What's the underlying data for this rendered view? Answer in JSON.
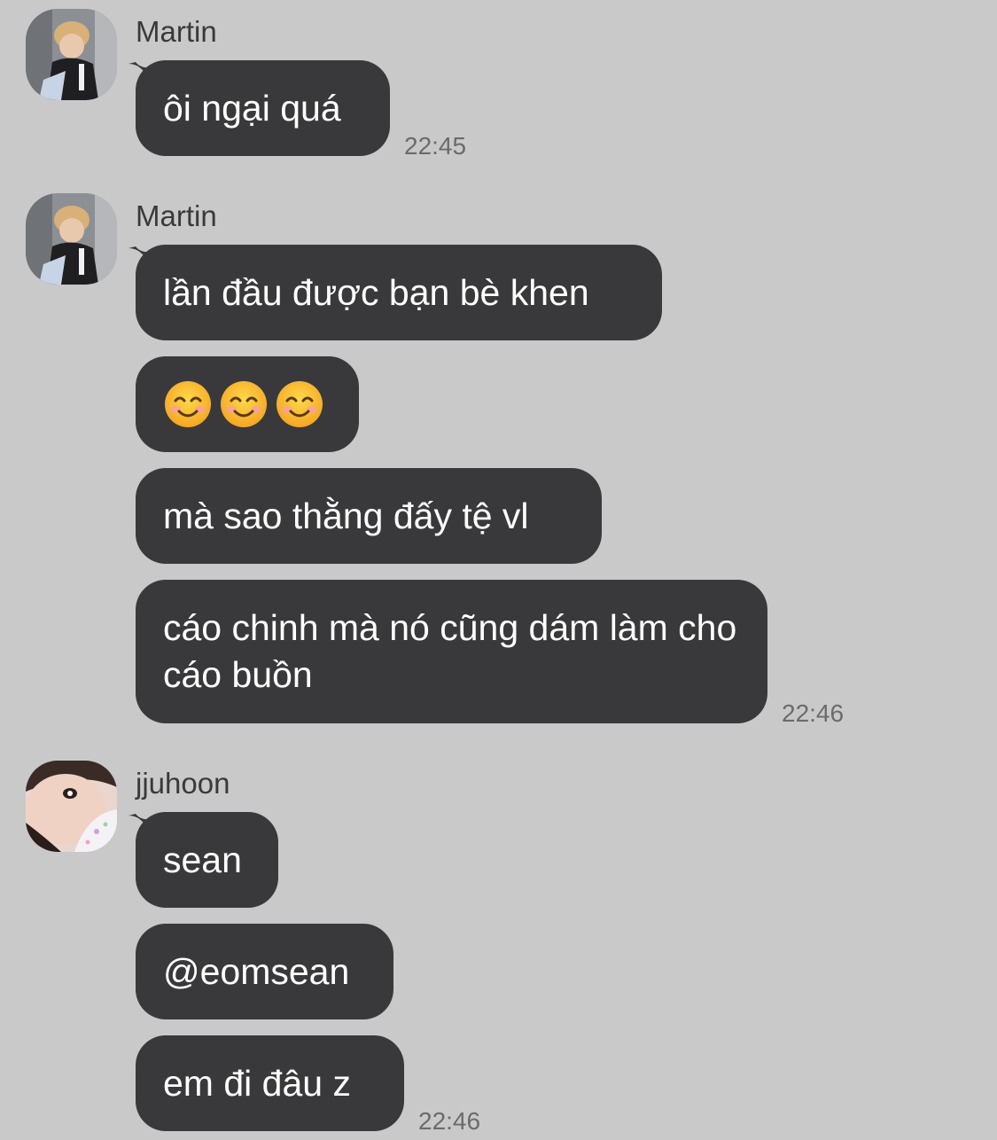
{
  "groups": [
    {
      "sender": "Martin",
      "messages": [
        "ôi ngại quá"
      ],
      "time": "22:45"
    },
    {
      "sender": "Martin",
      "messages": [
        "lần đầu được bạn bè khen",
        "😊😊😊",
        "mà sao thằng đấy tệ vl",
        "cáo chinh mà nó cũng dám làm cho cáo buồn"
      ],
      "time": "22:46"
    },
    {
      "sender": "jjuhoon",
      "messages": [
        "sean",
        "@eomsean",
        "em đi đâu z"
      ],
      "time": "22:46"
    }
  ],
  "colors": {
    "background": "#c9c9c9",
    "bubble": "#39393b",
    "bubble_text": "#ffffff",
    "sender_text": "#3a3a3a",
    "time_text": "#6b6b6b"
  }
}
